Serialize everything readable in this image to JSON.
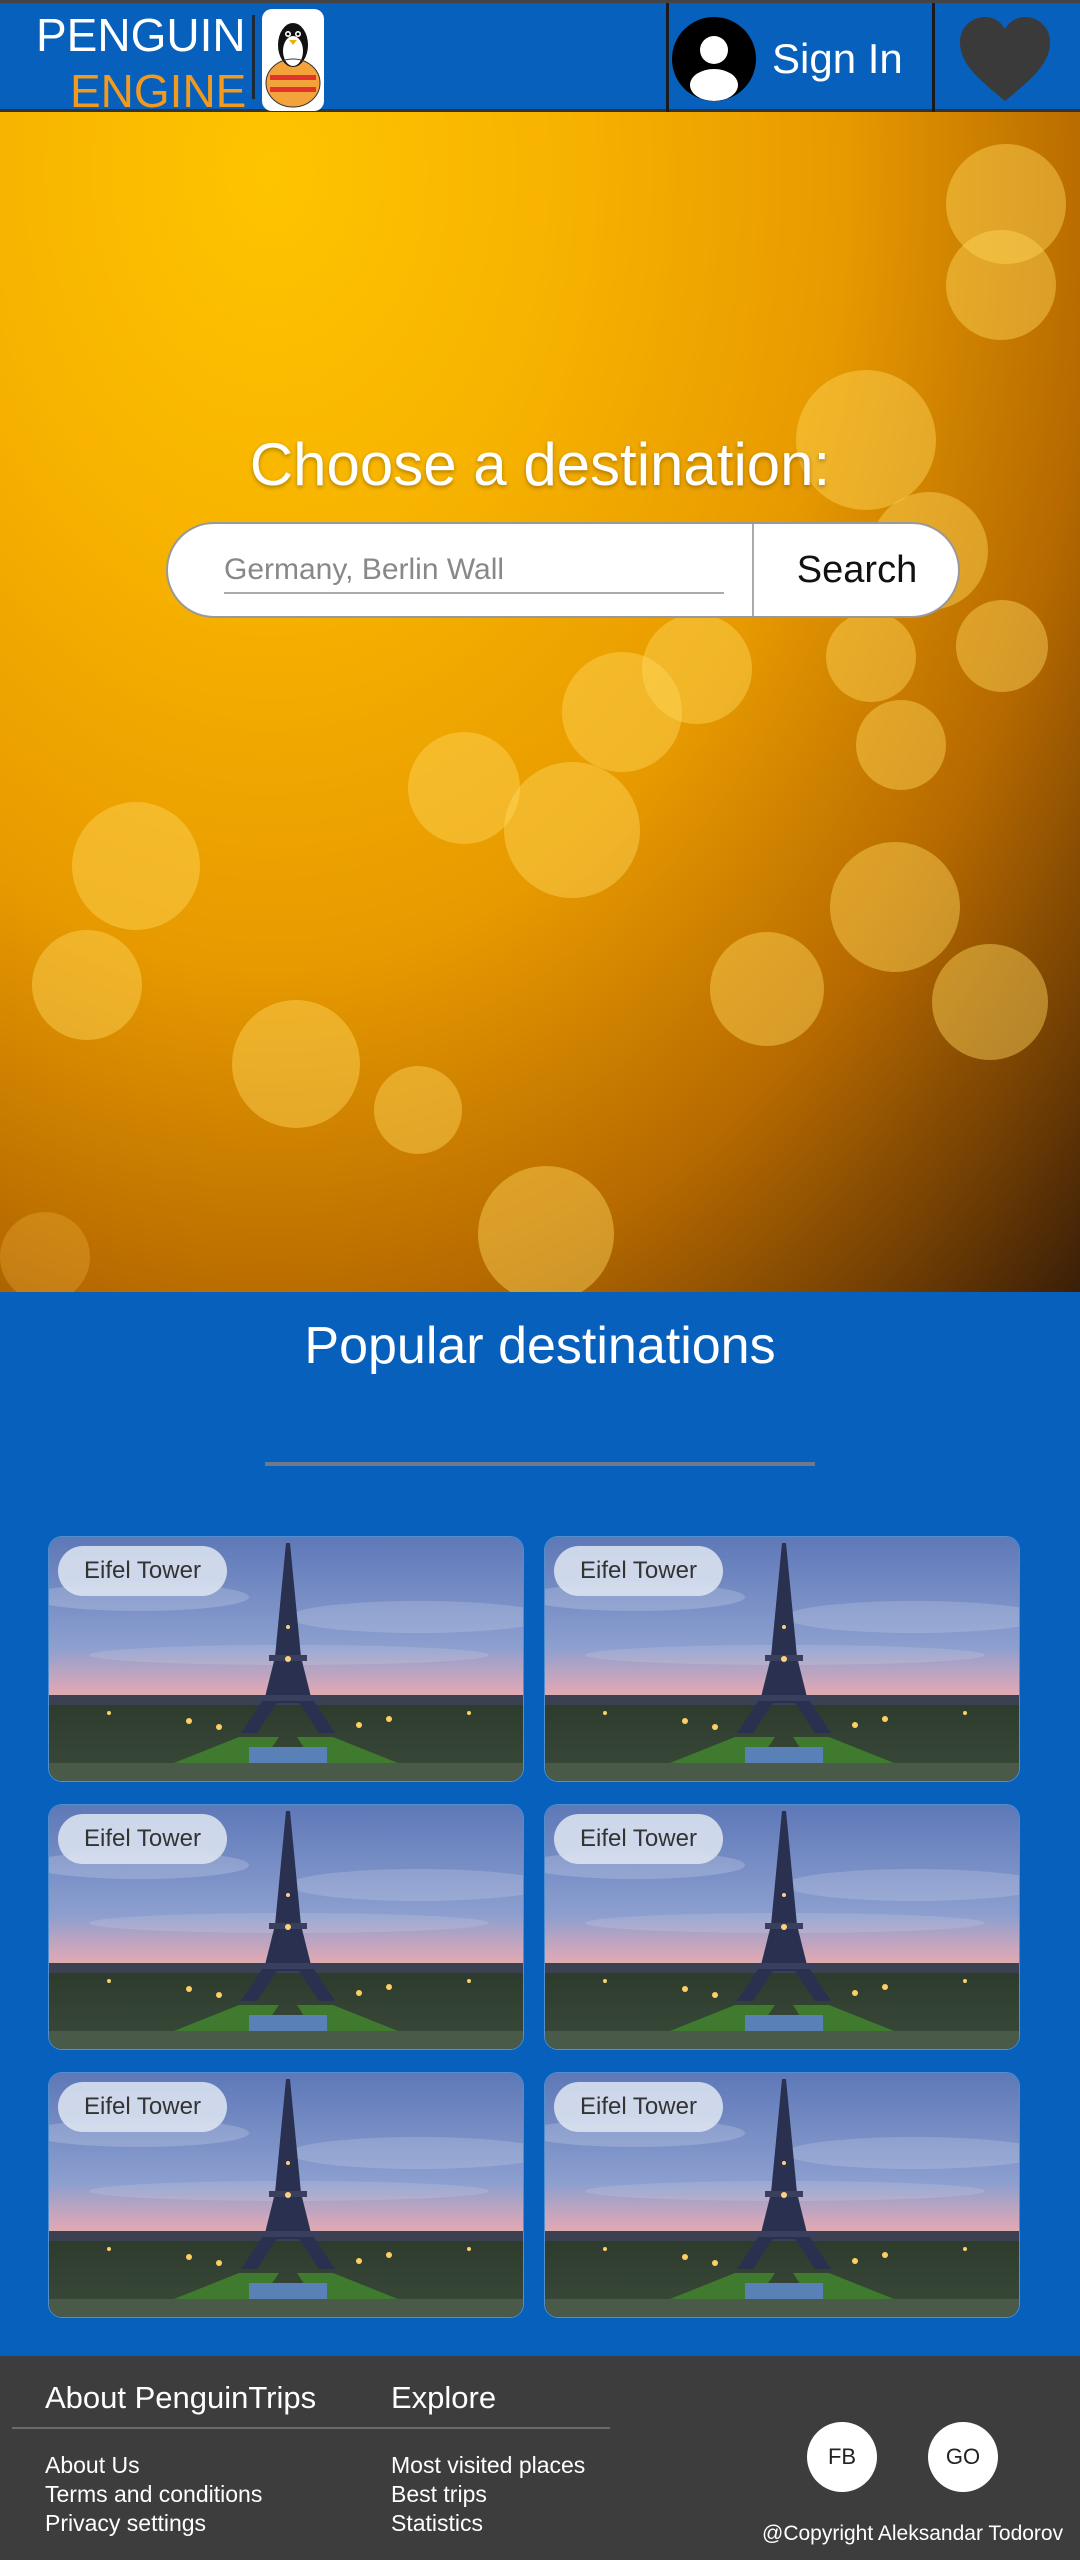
{
  "header": {
    "logo_line1": "PENGUIN",
    "logo_line2": "ENGINE",
    "signin_label": "Sign In",
    "icons": [
      "penguin-logo-icon",
      "user-avatar-icon",
      "heart-icon"
    ]
  },
  "hero": {
    "title": "Choose a destination:",
    "search_placeholder": "Germany, Berlin Wall",
    "search_button": "Search"
  },
  "popular": {
    "title": "Popular destinations",
    "cards": [
      {
        "label": "Eifel Tower"
      },
      {
        "label": "Eifel Tower"
      },
      {
        "label": "Eifel Tower"
      },
      {
        "label": "Eifel Tower"
      },
      {
        "label": "Eifel Tower"
      },
      {
        "label": "Eifel Tower"
      }
    ]
  },
  "footer": {
    "about_heading": "About PenguinTrips",
    "about_links": [
      "About Us",
      "Terms and conditions",
      "Privacy settings"
    ],
    "explore_heading": "Explore",
    "explore_links": [
      "Most visited places",
      "Best trips",
      "Statistics"
    ],
    "social": [
      "FB",
      "GO"
    ],
    "copyright": "@Copyright Aleksandar Todorov"
  },
  "colors": {
    "brand_blue": "#0660bc",
    "accent_orange": "#f39a1e",
    "footer_bg": "#3d3d3d",
    "heart": "#3a3a3a"
  }
}
